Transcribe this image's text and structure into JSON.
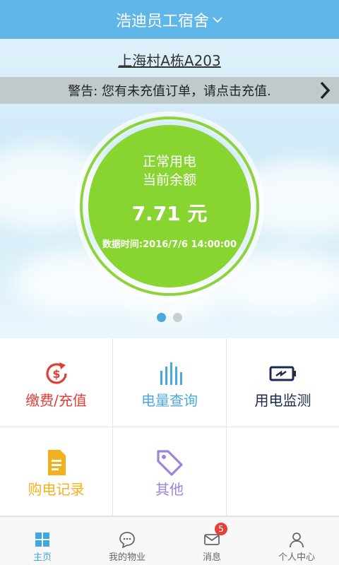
{
  "header": {
    "title": "浩迪员工宿舍",
    "dropdown_icon": "chevron-down-icon"
  },
  "address": "上海村A栋A203",
  "warning": {
    "text": "警告: 您有未充值订单，请点击充值.",
    "arrow_icon": "chevron-right-icon"
  },
  "meter": {
    "status": "正常用电",
    "label": "当前余额",
    "amount": "7.71 元",
    "time": "数据时间:2016/7/6 14:00:00",
    "ring_color": "#8fd33a",
    "fill_color": "#88d430"
  },
  "carousel": {
    "pages": 2,
    "active_index": 0
  },
  "grid": [
    {
      "label": "缴费/充值",
      "icon": "dollar-refresh-icon",
      "color": "#e03e36"
    },
    {
      "label": "电量查询",
      "icon": "bar-chart-icon",
      "color": "#4aa9e0"
    },
    {
      "label": "用电监测",
      "icon": "battery-icon",
      "color": "#1b2b4d"
    },
    {
      "label": "购电记录",
      "icon": "document-icon",
      "color": "#f2b01e"
    },
    {
      "label": "其他",
      "icon": "tag-icon",
      "color": "#9a85d9"
    }
  ],
  "nav": [
    {
      "label": "主页",
      "icon": "home-grid-icon",
      "active": true
    },
    {
      "label": "我的物业",
      "icon": "chat-bubble-icon",
      "active": false
    },
    {
      "label": "消息",
      "icon": "mail-icon",
      "active": false,
      "badge": "5"
    },
    {
      "label": "个人中心",
      "icon": "user-icon",
      "active": false
    }
  ],
  "colors": {
    "header_bg": "#5fb6e8",
    "accent": "#3ea7e1"
  }
}
